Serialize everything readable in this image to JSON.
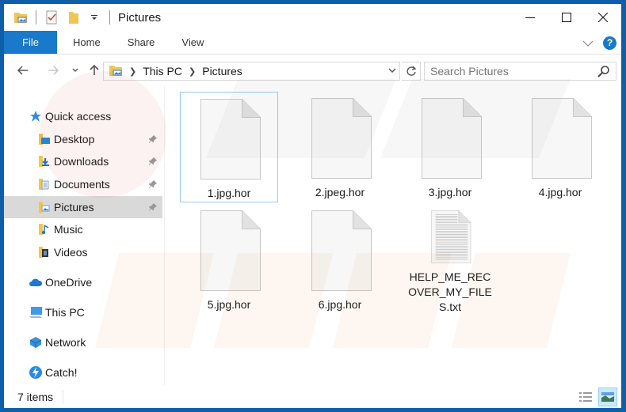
{
  "window": {
    "title": "Pictures",
    "controls": {
      "minimize": "minimize",
      "maximize": "maximize",
      "close": "close"
    }
  },
  "quick_access_toolbar": {
    "icons": [
      "properties-icon",
      "new-folder-icon",
      "customize-dropdown-icon"
    ]
  },
  "ribbon": {
    "file_tab": "File",
    "tabs": [
      "Home",
      "Share",
      "View"
    ],
    "help_label": "?"
  },
  "address_bar": {
    "breadcrumbs": [
      "This PC",
      "Pictures"
    ]
  },
  "search": {
    "placeholder": "Search Pictures"
  },
  "sidebar": {
    "quick_access_label": "Quick access",
    "pinned": [
      {
        "label": "Desktop",
        "icon": "desktop-folder-icon",
        "pinned": true
      },
      {
        "label": "Downloads",
        "icon": "downloads-folder-icon",
        "pinned": true
      },
      {
        "label": "Documents",
        "icon": "documents-folder-icon",
        "pinned": true
      },
      {
        "label": "Pictures",
        "icon": "pictures-folder-icon",
        "pinned": true,
        "selected": true
      },
      {
        "label": "Music",
        "icon": "music-folder-icon",
        "pinned": false
      },
      {
        "label": "Videos",
        "icon": "videos-folder-icon",
        "pinned": false
      }
    ],
    "roots": [
      {
        "label": "OneDrive",
        "icon": "onedrive-icon"
      },
      {
        "label": "This PC",
        "icon": "this-pc-icon"
      },
      {
        "label": "Network",
        "icon": "network-icon"
      },
      {
        "label": "Catch!",
        "icon": "catch-icon"
      }
    ]
  },
  "files": [
    {
      "name": "1.jpg.hor",
      "type": "blank",
      "focused": true
    },
    {
      "name": "2.jpeg.hor",
      "type": "blank"
    },
    {
      "name": "3.jpg.hor",
      "type": "blank"
    },
    {
      "name": "4.jpg.hor",
      "type": "blank"
    },
    {
      "name": "5.jpg.hor",
      "type": "blank"
    },
    {
      "name": "6.jpg.hor",
      "type": "blank"
    },
    {
      "name": "HELP_ME_RECOVER_MY_FILES.txt",
      "type": "text"
    }
  ],
  "status_bar": {
    "item_count": "7 items",
    "views": [
      "details-view",
      "large-icons-view"
    ],
    "active_view": "large-icons-view"
  },
  "colors": {
    "accent": "#1979ca",
    "window_border": "#0f5fa8",
    "selection": "#d9d9d9",
    "focus_border": "#99ccee"
  }
}
